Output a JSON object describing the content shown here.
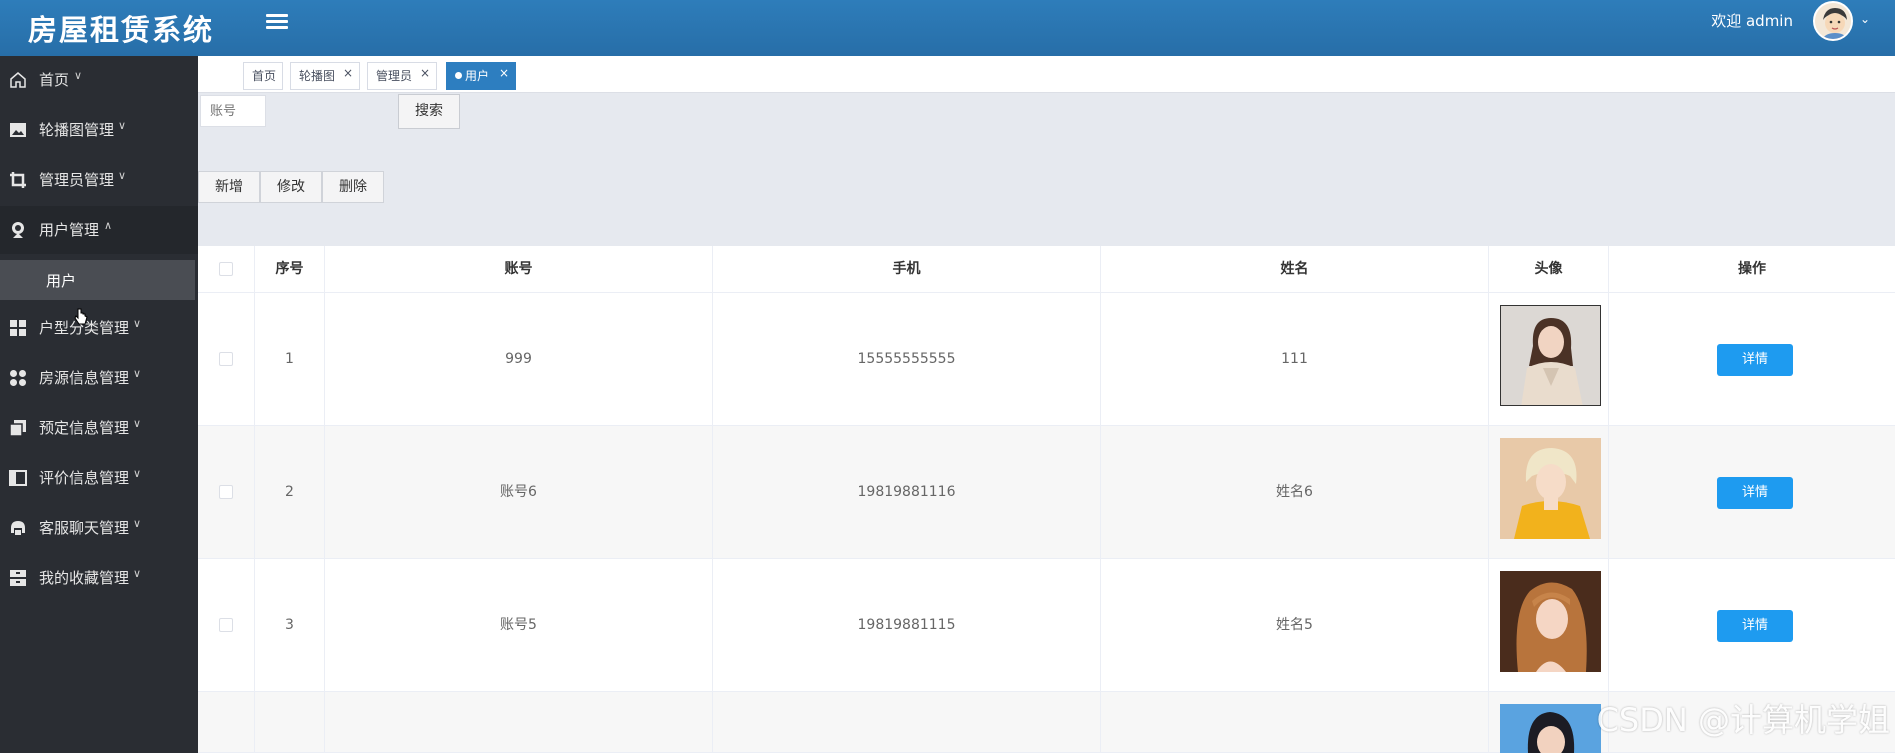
{
  "header": {
    "title": "房屋租赁系统",
    "welcome": "欢迎 admin"
  },
  "sidebar": {
    "items": [
      {
        "label": "首页",
        "icon": "home-icon"
      },
      {
        "label": "轮播图管理",
        "icon": "image-icon"
      },
      {
        "label": "管理员管理",
        "icon": "crop-icon"
      },
      {
        "label": "用户管理",
        "icon": "user-icon"
      },
      {
        "label": "户型分类管理",
        "icon": "grid-icon"
      },
      {
        "label": "房源信息管理",
        "icon": "apps-icon"
      },
      {
        "label": "预定信息管理",
        "icon": "copy-icon"
      },
      {
        "label": "评价信息管理",
        "icon": "panel-icon"
      },
      {
        "label": "客服聊天管理",
        "icon": "chat-icon"
      },
      {
        "label": "我的收藏管理",
        "icon": "drawer-icon"
      }
    ],
    "submenu": {
      "label": "用户"
    }
  },
  "tabs": [
    {
      "label": "首页"
    },
    {
      "label": "轮播图"
    },
    {
      "label": "管理员"
    },
    {
      "label": "用户"
    }
  ],
  "search": {
    "placeholder": "账号",
    "button": "搜索"
  },
  "actions": {
    "add": "新增",
    "edit": "修改",
    "delete": "删除"
  },
  "table": {
    "headers": [
      "序号",
      "账号",
      "手机",
      "姓名",
      "头像",
      "操作"
    ],
    "rows": [
      {
        "index": "1",
        "account": "999",
        "phone": "15555555555",
        "name": "111",
        "op": "详情"
      },
      {
        "index": "2",
        "account": "账号6",
        "phone": "19819881116",
        "name": "姓名6",
        "op": "详情"
      },
      {
        "index": "3",
        "account": "账号5",
        "phone": "19819881115",
        "name": "姓名5",
        "op": "详情"
      }
    ]
  },
  "watermark": "CSDN @计算机学姐",
  "colors": {
    "header": "#2e7dba",
    "sidebar": "#2a2d33",
    "primary": "#1e9bf0"
  }
}
